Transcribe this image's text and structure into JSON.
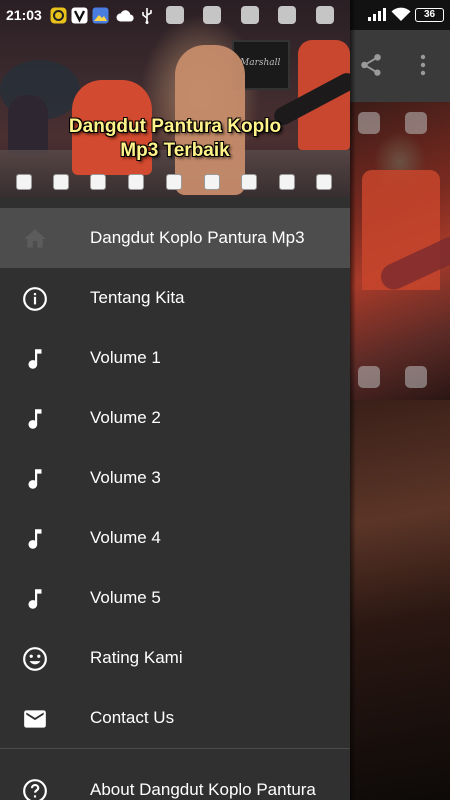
{
  "status_bar": {
    "time": "21:03",
    "battery": "36"
  },
  "drawer": {
    "header": {
      "title_line1": "Dangdut Pantura Koplo",
      "title_line2": "Mp3 Terbaik"
    },
    "items": [
      {
        "label": "Dangdut Koplo Pantura Mp3",
        "icon": "home-icon",
        "selected": true
      },
      {
        "label": "Tentang Kita",
        "icon": "info-icon"
      },
      {
        "label": "Volume 1",
        "icon": "music-note-icon"
      },
      {
        "label": "Volume 2",
        "icon": "music-note-icon"
      },
      {
        "label": "Volume 3",
        "icon": "music-note-icon"
      },
      {
        "label": "Volume 4",
        "icon": "music-note-icon"
      },
      {
        "label": "Volume 5",
        "icon": "music-note-icon"
      },
      {
        "label": "Rating Kami",
        "icon": "smiley-icon"
      },
      {
        "label": "Contact Us",
        "icon": "mail-icon"
      }
    ],
    "footer_item": {
      "label": "About Dangdut Koplo Pantura",
      "icon": "help-icon"
    }
  },
  "background_app": {
    "toolbar_icons": [
      "share-icon",
      "more-vert-icon"
    ]
  },
  "colors": {
    "drawer_bg": "#303030",
    "selected_bg": "#4d4d4d",
    "title_yellow": "#fff38a"
  }
}
